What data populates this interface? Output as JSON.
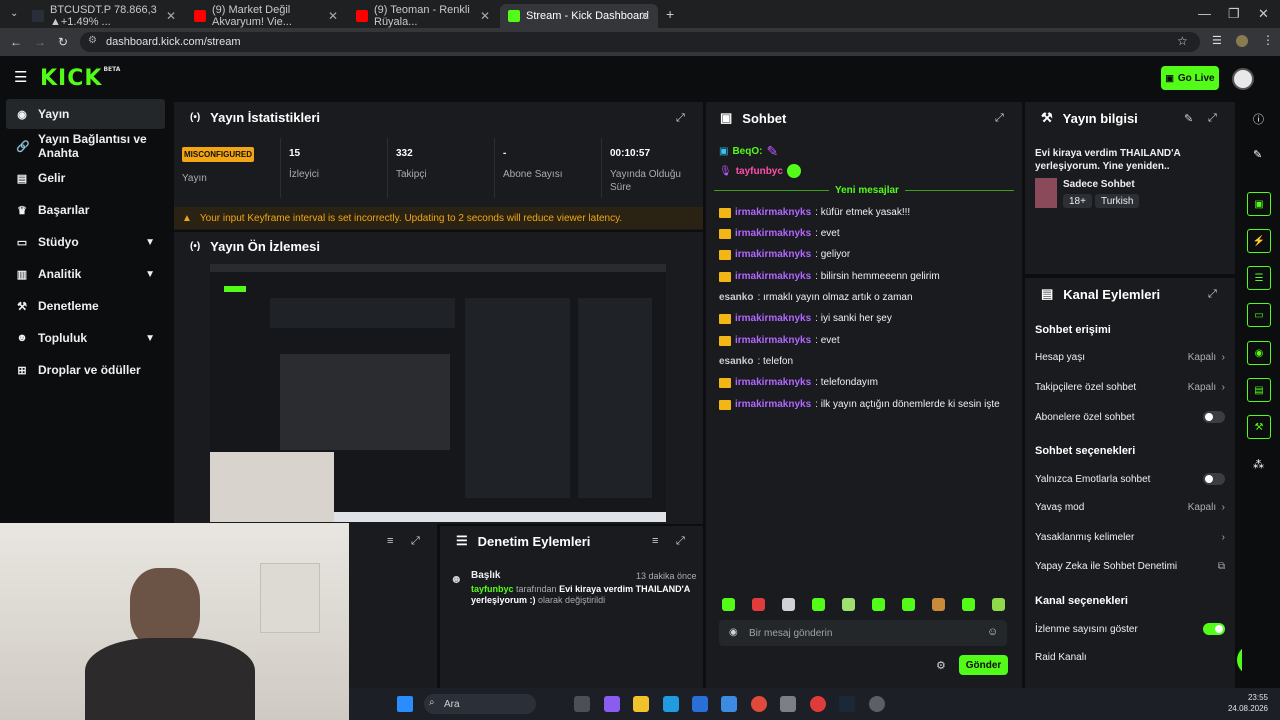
{
  "browser": {
    "tabs": [
      {
        "label": "BTCUSDT.P 78.866,3 ▲+1.49% ..."
      },
      {
        "label": "(9) Market Değil Akvaryum! Vie..."
      },
      {
        "label": "(9) Teoman - Renkli Rüyala..."
      },
      {
        "label": "Stream - Kick Dashboard"
      }
    ],
    "url": "dashboard.kick.com/stream"
  },
  "header": {
    "logo": "KICK",
    "logo_badge": "BETA",
    "go_live": "Go Live"
  },
  "sidebar": {
    "items": [
      {
        "label": "Yayın",
        "icon": "broadcast-icon"
      },
      {
        "label": "Yayın Bağlantısı ve Anahta",
        "icon": "link-icon"
      },
      {
        "label": "Gelir",
        "icon": "money-icon"
      },
      {
        "label": "Başarılar",
        "icon": "trophy-icon"
      },
      {
        "label": "Stüdyo",
        "icon": "studio-icon"
      },
      {
        "label": "Analitik",
        "icon": "chart-icon"
      },
      {
        "label": "Denetleme",
        "icon": "wrench-icon"
      },
      {
        "label": "Topluluk",
        "icon": "people-icon"
      },
      {
        "label": "Droplar ve ödüller",
        "icon": "gift-icon"
      }
    ]
  },
  "stats": {
    "title": "Yayın İstatistikleri",
    "badge": "MISCONFIGURED",
    "badge_label": "Yayın",
    "viewers": {
      "value": "15",
      "label": "İzleyici"
    },
    "followers": {
      "value": "332",
      "label": "Takipçi"
    },
    "subs": {
      "value": "-",
      "label": "Abone Sayısı"
    },
    "uptime": {
      "value": "00:10:57",
      "label1": "Yayında Olduğu",
      "label2": "Süre"
    },
    "warning": "Your input Keyframe interval is set incorrectly. Updating to 2 seconds will reduce viewer latency."
  },
  "preview": {
    "title": "Yayın Ön İzlemesi"
  },
  "mod": {
    "title": "Denetim Eylemleri",
    "entry_title": "Başlık",
    "entry_time": "13 dakika önce",
    "entry_user": "tayfunbyc",
    "entry_mid": "tarafından",
    "entry_text": "Evi kiraya verdim THAILAND'A yerleşiyorum :)",
    "entry_end": "olarak değiştirildi"
  },
  "chat": {
    "title": "Sohbet",
    "pinned": [
      {
        "user": "BeqO:"
      },
      {
        "user": "tayfunbyc"
      }
    ],
    "new_messages": "Yeni mesajlar",
    "messages": [
      {
        "user": "irmakirmaknyks",
        "text": ": küfür etmek yasak!!!"
      },
      {
        "user": "irmakirmaknyks",
        "text": ": evet"
      },
      {
        "user": "irmakirmaknyks",
        "text": ": geliyor"
      },
      {
        "user": "irmakirmaknyks",
        "text": ": bilirsin hemmeeenn gelirim"
      },
      {
        "user": "esanko",
        "text": ": ırmaklı yayın olmaz artık o zaman"
      },
      {
        "user": "irmakirmaknyks",
        "text": ": iyi sanki her şey"
      },
      {
        "user": "irmakirmaknyks",
        "text": ": evet"
      },
      {
        "user": "esanko",
        "text": ": telefon"
      },
      {
        "user": "irmakirmaknyks",
        "text": ": telefondayım"
      },
      {
        "user": "irmakirmaknyks",
        "text": ": ilk yayın açtığın dönemlerde ki sesin işte"
      }
    ],
    "placeholder": "Bir mesaj gönderin",
    "send": "Gönder"
  },
  "info": {
    "title": "Yayın bilgisi",
    "stream_title": "Evi kiraya verdim THAILAND'A yerleşiyorum. Yine yeniden..",
    "category": "Sadece Sohbet",
    "tags": [
      "18+",
      "Turkish"
    ]
  },
  "actions": {
    "title": "Kanal Eylemleri",
    "sec1": "Sohbet erişimi",
    "account_age": {
      "label": "Hesap yaşı",
      "value": "Kapalı"
    },
    "followers_only": {
      "label": "Takipçilere özel sohbet",
      "value": "Kapalı"
    },
    "subs_only": {
      "label": "Abonelere özel sohbet",
      "on": false
    },
    "sec2": "Sohbet seçenekleri",
    "emotes_only": {
      "label": "Yalnızca Emotlarla sohbet",
      "on": false
    },
    "slow_mode": {
      "label": "Yavaş mod",
      "value": "Kapalı"
    },
    "banned_words": {
      "label": "Yasaklanmış kelimeler"
    },
    "ai_mod": {
      "label": "Yapay Zeka ile Sohbet Denetimi"
    },
    "sec3": "Kanal seçenekleri",
    "show_viewers": {
      "label": "İzlenme sayısını göster",
      "on": true
    },
    "raid": {
      "label": "Raid Kanalı"
    }
  },
  "taskbar": {
    "search": "Ara",
    "time": "23:55",
    "date": "24.08.2026"
  },
  "colors": {
    "accent": "#53fc18",
    "warning": "#f2a614",
    "username": "#b366ff",
    "panel": "#191b1f"
  }
}
